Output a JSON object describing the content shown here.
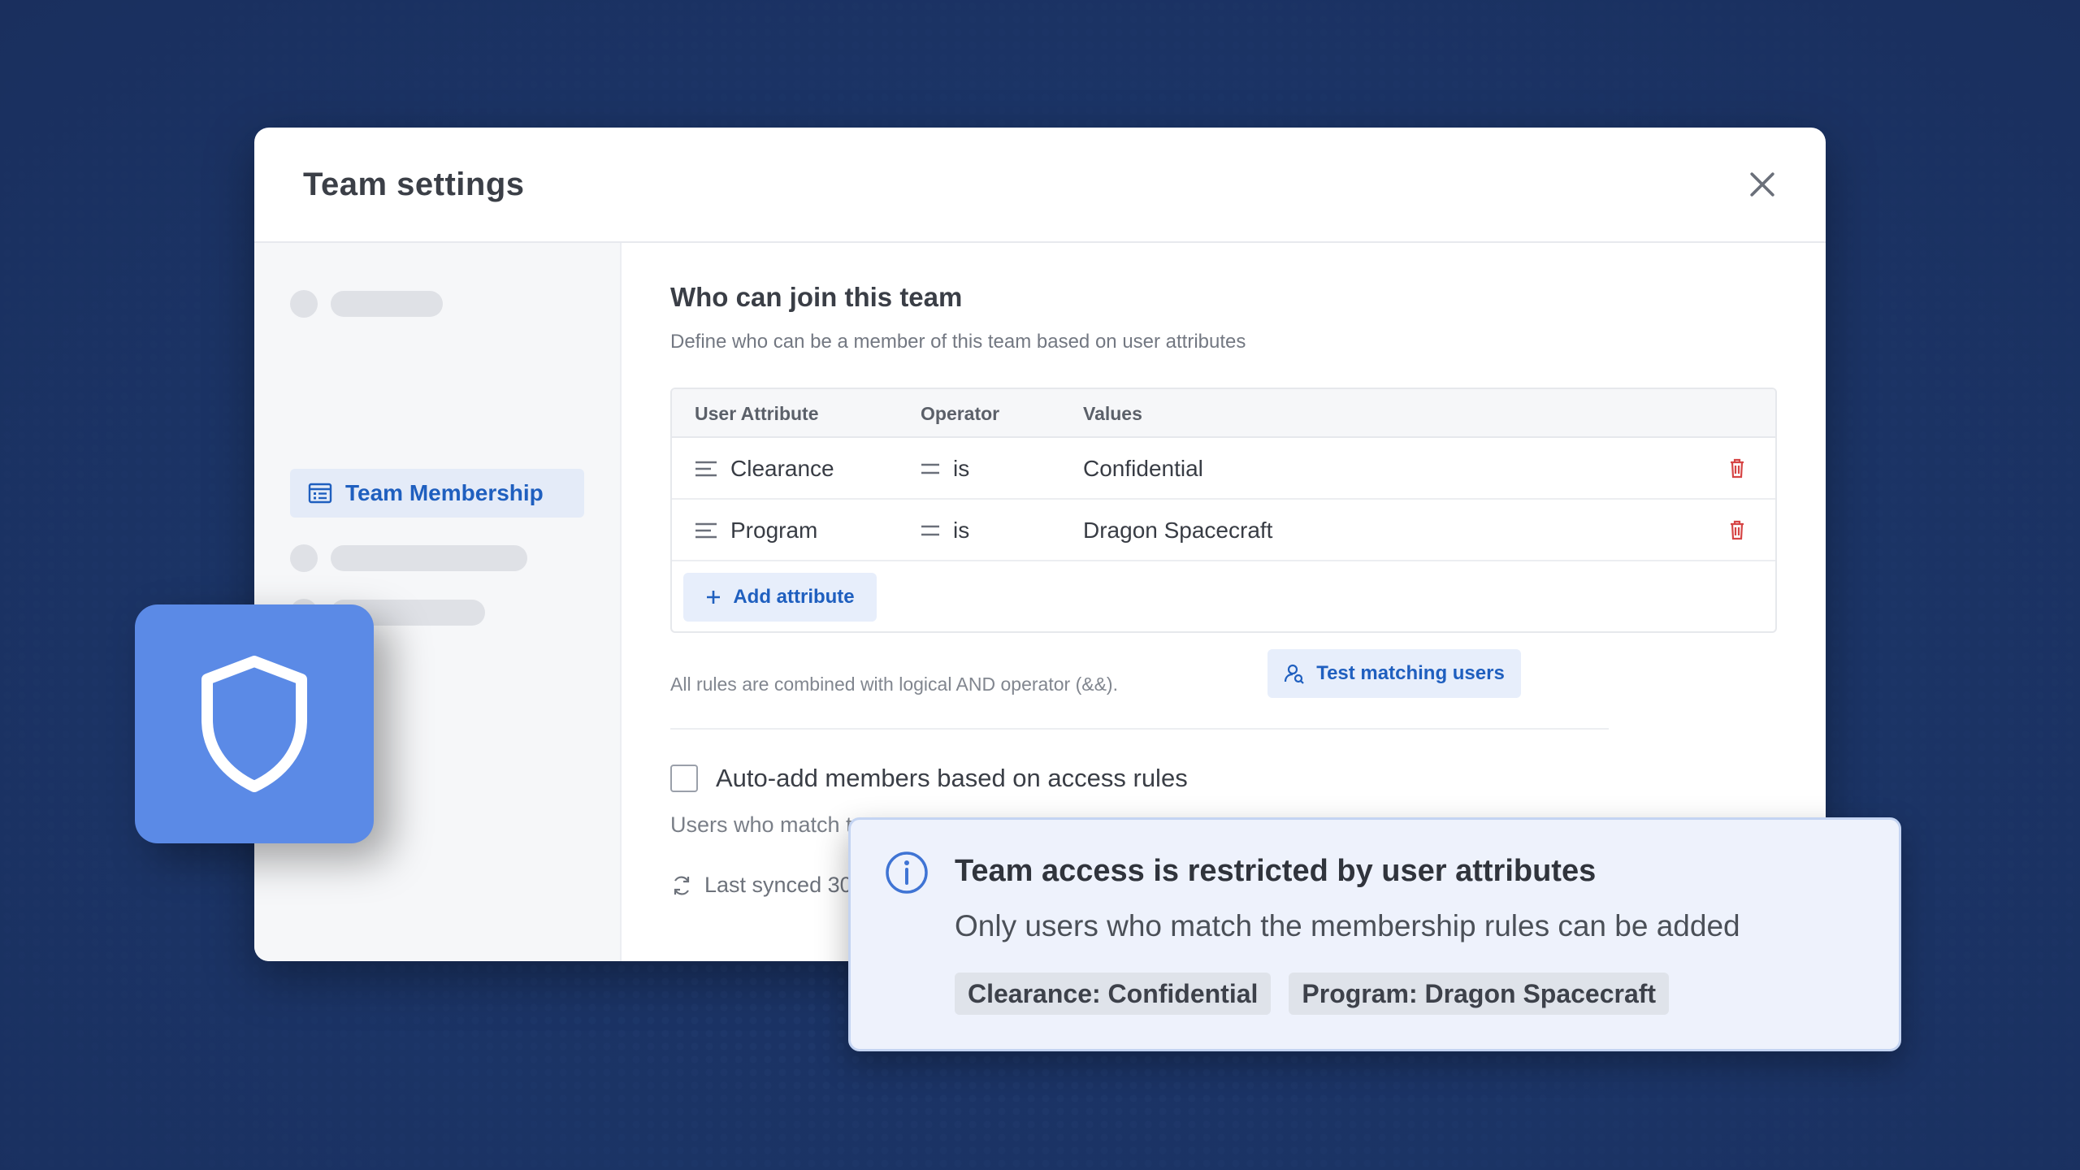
{
  "modal": {
    "title": "Team settings",
    "close_icon": "close-icon"
  },
  "sidebar": {
    "active_item": {
      "label": "Team Membership",
      "icon": "list-icon"
    }
  },
  "section": {
    "title": "Who can join this team",
    "description": "Define who can be a member of this team based on user attributes"
  },
  "table": {
    "headers": [
      "User Attribute",
      "Operator",
      "Values"
    ],
    "rows": [
      {
        "attribute": "Clearance",
        "operator": "is",
        "value": "Confidential"
      },
      {
        "attribute": "Program",
        "operator": "is",
        "value": "Dragon Spacecraft"
      }
    ],
    "add_label": "Add attribute"
  },
  "rules_note": "All rules are combined with logical AND operator (&&).",
  "test_button": "Test matching users",
  "auto_add": {
    "label": "Auto-add members based on access rules",
    "checked": false,
    "helper": "Users who match t",
    "synced": "Last synced 30"
  },
  "callout": {
    "title": "Team access is restricted by user attributes",
    "description": "Only users who match the membership rules can be added",
    "chips": [
      "Clearance: Confidential",
      "Program: Dragon Spacecraft"
    ]
  },
  "colors": {
    "accent": "#1f5fbf",
    "shield_tile": "#5b8ae6",
    "danger": "#d64545",
    "background": "#1c3466"
  }
}
